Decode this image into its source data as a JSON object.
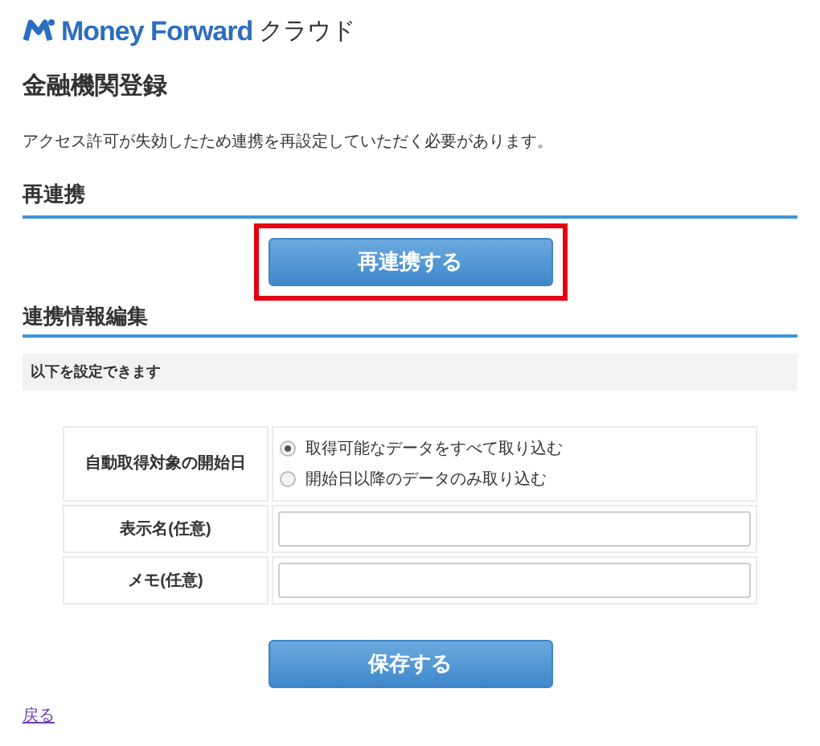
{
  "logo": {
    "brand": "Money Forward",
    "product": "クラウド"
  },
  "page_title": "金融機関登録",
  "message": "アクセス許可が失効したため連携を再設定していただく必要があります。",
  "reconnect_section": {
    "heading": "再連携",
    "button": {
      "label": "再連携する",
      "highlighted": true
    }
  },
  "edit_section": {
    "heading": "連携情報編集",
    "notice": "以下を設定できます",
    "rows": [
      {
        "kind": "radio",
        "label": "自動取得対象の開始日",
        "options": [
          {
            "label": "取得可能なデータをすべて取り込む",
            "selected": true
          },
          {
            "label": "開始日以降のデータのみ取り込む",
            "selected": false
          }
        ]
      },
      {
        "kind": "text",
        "label": "表示名(任意)"
      },
      {
        "kind": "text",
        "label": "メモ(任意)"
      }
    ],
    "save_button": "保存する"
  },
  "back_link": "戻る"
}
